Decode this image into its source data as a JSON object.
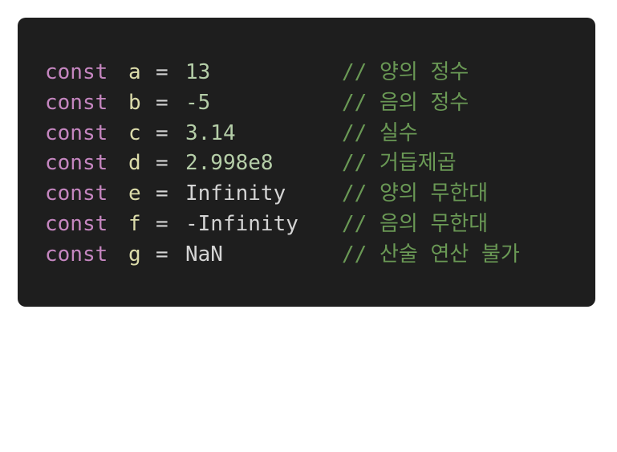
{
  "colors": {
    "background": "#1e1e1e",
    "keyword": "#c586c0",
    "identifier": "#dcdcaa",
    "operator": "#d4d4d4",
    "number": "#b5cea8",
    "plain_value": "#d4d4d4",
    "comment": "#6a9955"
  },
  "lines": [
    {
      "keyword": "const",
      "identifier": "a",
      "operator": "=",
      "value": "13",
      "value_kind": "number",
      "comment": "// 양의 정수"
    },
    {
      "keyword": "const",
      "identifier": "b",
      "operator": "=",
      "value": "-5",
      "value_kind": "number",
      "comment": "// 음의 정수"
    },
    {
      "keyword": "const",
      "identifier": "c",
      "operator": "=",
      "value": "3.14",
      "value_kind": "number",
      "comment": "// 실수"
    },
    {
      "keyword": "const",
      "identifier": "d",
      "operator": "=",
      "value": "2.998e8",
      "value_kind": "number",
      "comment": "// 거듭제곱"
    },
    {
      "keyword": "const",
      "identifier": "e",
      "operator": "=",
      "value": "Infinity",
      "value_kind": "plain",
      "comment": "// 양의 무한대"
    },
    {
      "keyword": "const",
      "identifier": "f",
      "operator": "=",
      "value": "-Infinity",
      "value_kind": "plain",
      "comment": "// 음의 무한대"
    },
    {
      "keyword": "const",
      "identifier": "g",
      "operator": "=",
      "value": "NaN",
      "value_kind": "plain",
      "comment": "// 산술 연산 불가"
    }
  ]
}
